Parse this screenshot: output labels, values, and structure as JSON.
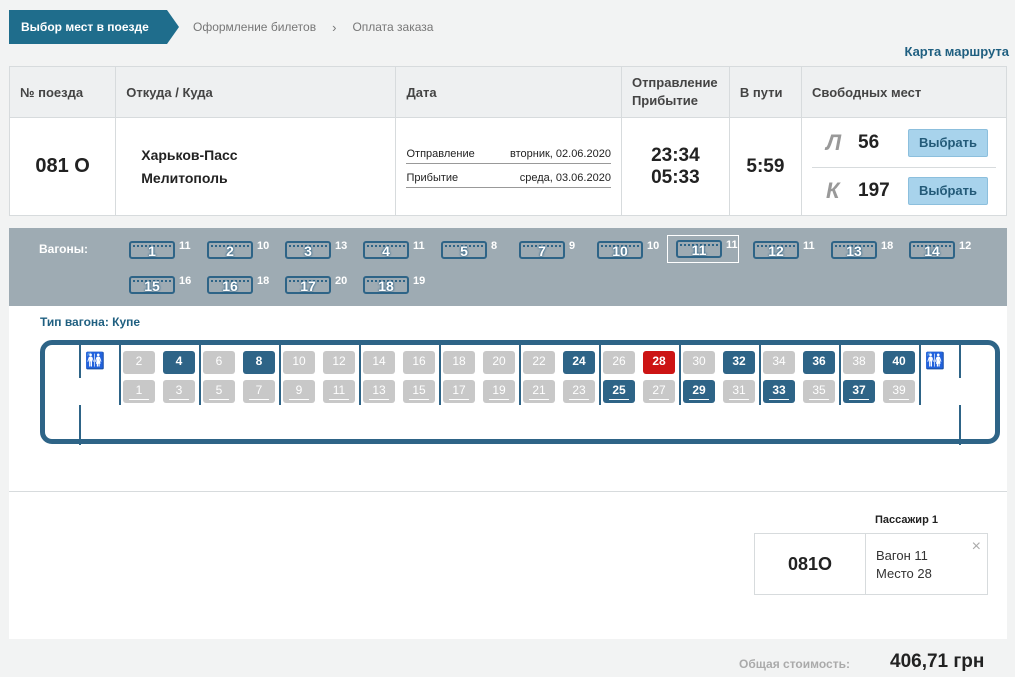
{
  "breadcrumbs": {
    "step1": "Выбор мест в поезде",
    "step2": "Оформление билетов",
    "step3": "Оплата заказа",
    "sep": "›"
  },
  "route_map_link": "Карта маршрута",
  "table": {
    "headers": {
      "train_no": "№ поезда",
      "from_to": "Откуда / Куда",
      "date": "Дата",
      "dep_arr": "Отправление Прибытие",
      "duration": "В пути",
      "free": "Свободных мест"
    },
    "train_no": "081 О",
    "from": "Харьков-Пасс",
    "to": "Мелитополь",
    "dep_label": "Отправление",
    "dep_date": "вторник, 02.06.2020",
    "arr_label": "Прибытие",
    "arr_date": "среда, 03.06.2020",
    "dep_time": "23:34",
    "arr_time": "05:33",
    "duration": "5:59",
    "classes": [
      {
        "code": "Л",
        "count": "56",
        "button": "Выбрать"
      },
      {
        "code": "К",
        "count": "197",
        "button": "Выбрать"
      }
    ]
  },
  "wagons": {
    "label": "Вагоны:",
    "selected": "11",
    "items": [
      {
        "num": "1",
        "free": "11"
      },
      {
        "num": "2",
        "free": "10"
      },
      {
        "num": "3",
        "free": "13"
      },
      {
        "num": "4",
        "free": "11"
      },
      {
        "num": "5",
        "free": "8"
      },
      {
        "num": "7",
        "free": "9"
      },
      {
        "num": "10",
        "free": "10"
      },
      {
        "num": "11",
        "free": "11"
      },
      {
        "num": "12",
        "free": "11"
      },
      {
        "num": "13",
        "free": "18"
      },
      {
        "num": "14",
        "free": "12"
      },
      {
        "num": "15",
        "free": "16"
      },
      {
        "num": "16",
        "free": "18"
      },
      {
        "num": "17",
        "free": "20"
      },
      {
        "num": "18",
        "free": "19"
      }
    ]
  },
  "car": {
    "type_label": "Тип вагона: Купе",
    "upper": [
      [
        "2",
        "busy"
      ],
      [
        "4",
        "free"
      ],
      [
        "6",
        "busy"
      ],
      [
        "8",
        "free"
      ],
      [
        "10",
        "busy"
      ],
      [
        "12",
        "busy"
      ],
      [
        "14",
        "busy"
      ],
      [
        "16",
        "busy"
      ],
      [
        "18",
        "busy"
      ],
      [
        "20",
        "busy"
      ],
      [
        "22",
        "busy"
      ],
      [
        "24",
        "free"
      ],
      [
        "26",
        "busy"
      ],
      [
        "28",
        "selected"
      ],
      [
        "30",
        "busy"
      ],
      [
        "32",
        "free"
      ],
      [
        "34",
        "busy"
      ],
      [
        "36",
        "free"
      ],
      [
        "38",
        "busy"
      ],
      [
        "40",
        "free"
      ]
    ],
    "lower": [
      [
        "1",
        "busy"
      ],
      [
        "3",
        "busy"
      ],
      [
        "5",
        "busy"
      ],
      [
        "7",
        "busy"
      ],
      [
        "9",
        "busy"
      ],
      [
        "11",
        "busy"
      ],
      [
        "13",
        "busy"
      ],
      [
        "15",
        "busy"
      ],
      [
        "17",
        "busy"
      ],
      [
        "19",
        "busy"
      ],
      [
        "21",
        "busy"
      ],
      [
        "23",
        "busy"
      ],
      [
        "25",
        "free"
      ],
      [
        "27",
        "busy"
      ],
      [
        "29",
        "free"
      ],
      [
        "31",
        "busy"
      ],
      [
        "33",
        "free"
      ],
      [
        "35",
        "busy"
      ],
      [
        "37",
        "free"
      ],
      [
        "39",
        "busy"
      ]
    ]
  },
  "passenger": {
    "title": "Пассажир 1",
    "train": "081О",
    "wagon": "Вагон 11",
    "seat": "Место 28",
    "close": "×"
  },
  "total": {
    "label": "Общая стоимость:",
    "value": "406,71 грн"
  },
  "colors": {
    "primary": "#1f6d8c",
    "free_seat": "#2e6487",
    "selected_seat": "#cc1414",
    "busy_seat": "#c8c8c8"
  }
}
